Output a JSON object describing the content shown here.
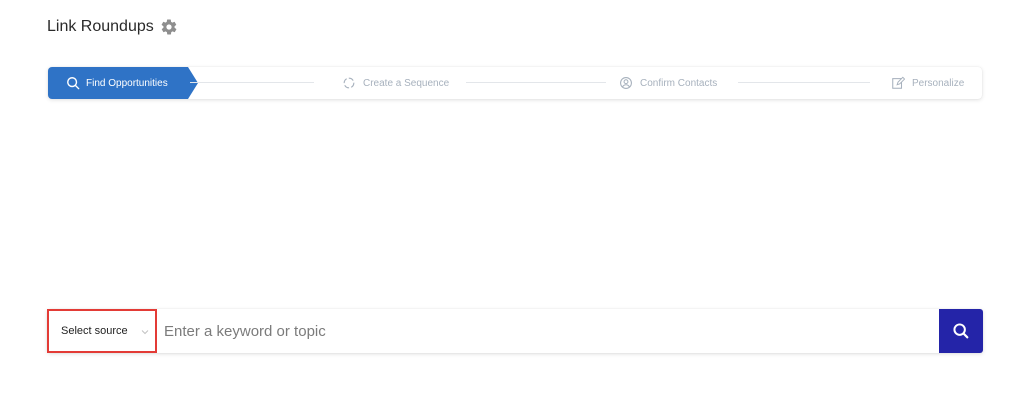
{
  "header": {
    "title": "Link Roundups",
    "settings_icon": "gear-icon"
  },
  "stepper": {
    "steps": [
      {
        "label": "Find Opportunities",
        "icon": "search-icon",
        "state": "active"
      },
      {
        "label": "Create a Sequence",
        "icon": "refresh-icon",
        "state": "inactive"
      },
      {
        "label": "Confirm Contacts",
        "icon": "user-circle-icon",
        "state": "inactive"
      },
      {
        "label": "Personalize",
        "icon": "edit-icon",
        "state": "inactive"
      }
    ]
  },
  "search": {
    "source_label": "Select source",
    "keyword_placeholder": "Enter a keyword or topic",
    "button_icon": "search-icon"
  },
  "colors": {
    "active_step": "#2f73c6",
    "inactive_step_text": "#a7b1bd",
    "search_button": "#2424a8",
    "highlight_border": "#e33b36"
  }
}
